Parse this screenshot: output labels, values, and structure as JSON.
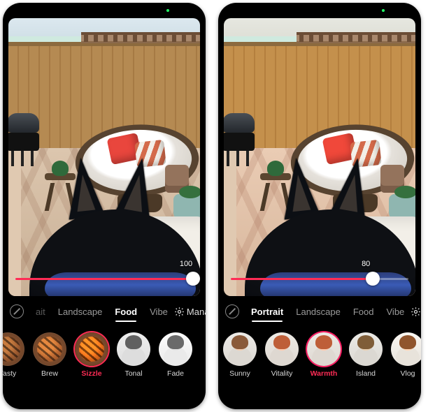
{
  "left": {
    "slider": {
      "value": 100,
      "max": 100
    },
    "categories": {
      "cutoff": "ait",
      "items": [
        "Landscape",
        "Food",
        "Vibe"
      ],
      "active": "Food",
      "manage_label": "Manage"
    },
    "filters": [
      {
        "id": "tasty",
        "label": "Tasty",
        "kind": "food",
        "variant": "v1"
      },
      {
        "id": "brew",
        "label": "Brew",
        "kind": "food",
        "variant": "v2"
      },
      {
        "id": "sizzle",
        "label": "Sizzle",
        "kind": "food",
        "variant": "v3",
        "selected": true
      },
      {
        "id": "tonal",
        "label": "Tonal",
        "kind": "face",
        "variant": "bw"
      },
      {
        "id": "fade",
        "label": "Fade",
        "kind": "face",
        "variant": "bw2"
      }
    ]
  },
  "right": {
    "slider": {
      "value": 80,
      "max": 100
    },
    "categories": {
      "items": [
        "Portrait",
        "Landscape",
        "Food",
        "Vibe"
      ],
      "active": "Portrait"
    },
    "filters": [
      {
        "id": "sunny",
        "label": "Sunny",
        "kind": "face",
        "variant": ""
      },
      {
        "id": "vitality",
        "label": "Vitality",
        "kind": "face",
        "variant": "warm"
      },
      {
        "id": "warmth",
        "label": "Warmth",
        "kind": "face",
        "variant": "warm",
        "selected": true
      },
      {
        "id": "island",
        "label": "Island",
        "kind": "face",
        "variant": "cool"
      },
      {
        "id": "vlog",
        "label": "Vlog",
        "kind": "face",
        "variant": "vlog"
      }
    ]
  }
}
